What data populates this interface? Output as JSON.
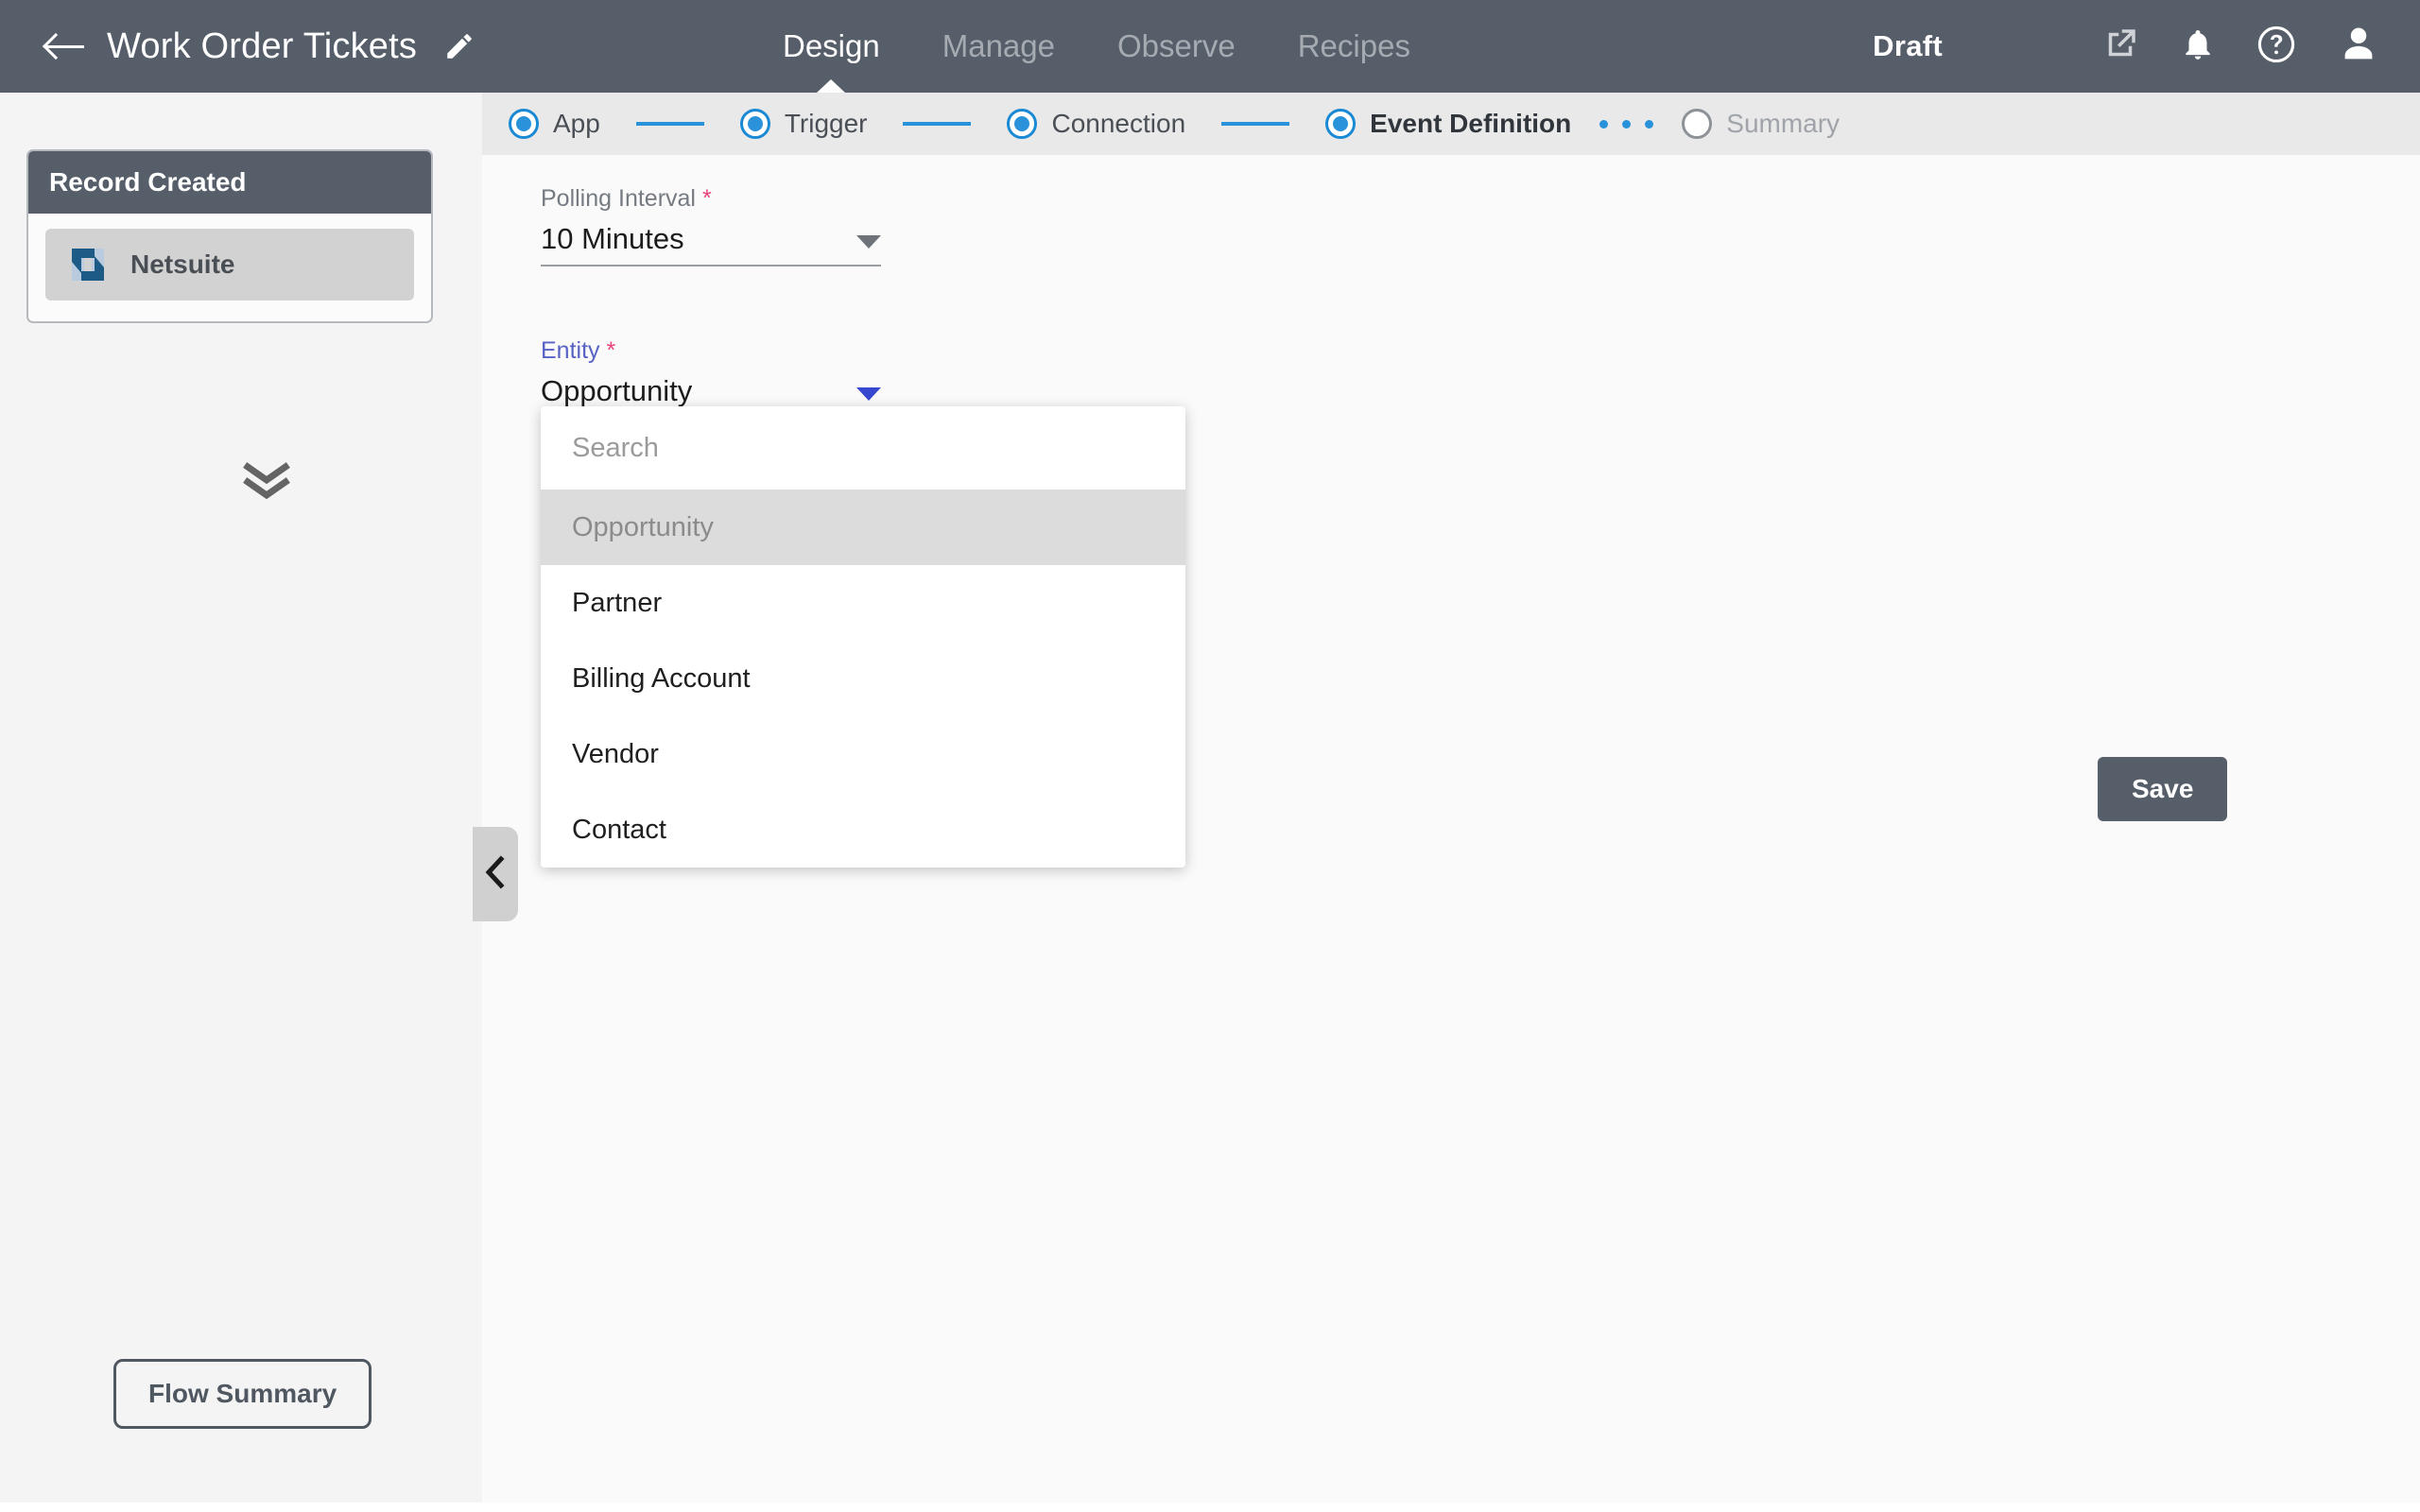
{
  "header": {
    "back_icon": "back-arrow-icon",
    "title": "Work Order Tickets",
    "edit_icon": "pencil-icon",
    "tabs": [
      {
        "label": "Design",
        "active": true
      },
      {
        "label": "Manage",
        "active": false
      },
      {
        "label": "Observe",
        "active": false
      },
      {
        "label": "Recipes",
        "active": false
      }
    ],
    "status": "Draft",
    "icons": [
      "external-link-icon",
      "bell-icon",
      "help-circle-icon",
      "user-avatar-icon"
    ],
    "background_color": "#565e6a"
  },
  "stepper": {
    "steps": [
      {
        "label": "App",
        "state": "complete",
        "bold": false
      },
      {
        "label": "Trigger",
        "state": "complete",
        "bold": false
      },
      {
        "label": "Connection",
        "state": "complete",
        "bold": false
      },
      {
        "label": "Event Definition",
        "state": "current",
        "bold": true
      },
      {
        "label": "Summary",
        "state": "pending",
        "bold": false
      }
    ],
    "accent_color": "#2a92da",
    "background_color": "#e9e9e9"
  },
  "left_panel": {
    "node_card": {
      "title": "Record Created",
      "items": [
        {
          "label": "Netsuite",
          "icon": "netsuite-logo-icon"
        }
      ]
    },
    "expand_icon": "double-chevron-down-icon",
    "flow_summary_button": "Flow Summary",
    "collapse_icon": "chevron-left-icon"
  },
  "main": {
    "fields": [
      {
        "label": "Polling Interval",
        "required": true,
        "value": "10 Minutes",
        "focused": false
      },
      {
        "label": "Entity",
        "required": true,
        "value": "Opportunity",
        "focused": true
      }
    ],
    "dropdown": {
      "search_placeholder": "Search",
      "search_value": "",
      "options": [
        {
          "label": "Opportunity",
          "selected": true
        },
        {
          "label": "Partner",
          "selected": false
        },
        {
          "label": "Billing Account",
          "selected": false
        },
        {
          "label": "Vendor",
          "selected": false
        },
        {
          "label": "Contact",
          "selected": false
        }
      ]
    },
    "save_button": "Save"
  }
}
